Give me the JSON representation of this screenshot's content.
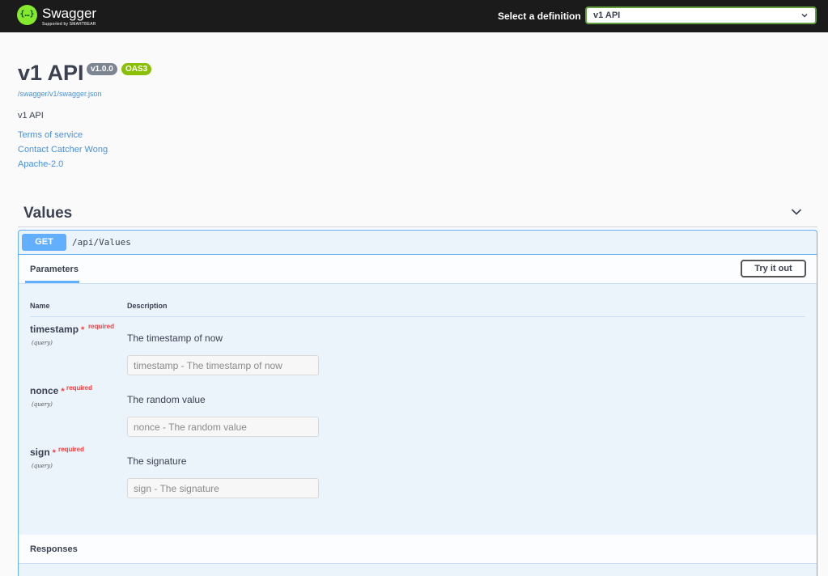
{
  "topbar": {
    "logo_text": "Swagger",
    "logo_sub": "Supported by SMARTBEAR",
    "logo_glyph": "{…}",
    "select_label": "Select a definition",
    "selected_definition": "v1 API"
  },
  "info": {
    "title": "v1 API",
    "version": "v1.0.0",
    "oas": "OAS3",
    "spec_url": "/swagger/v1/swagger.json",
    "description": "v1 API",
    "links": [
      "Terms of service",
      "Contact Catcher Wong",
      "Apache-2.0"
    ]
  },
  "tag": {
    "name": "Values"
  },
  "operation": {
    "method": "GET",
    "path": "/api/Values",
    "parameters_tab": "Parameters",
    "try_button": "Try it out",
    "columns": {
      "name": "Name",
      "description": "Description"
    },
    "params": [
      {
        "name": "timestamp",
        "star": "*",
        "required": "required",
        "in": "(query)",
        "description": "The timestamp of now",
        "placeholder": "timestamp - The timestamp of now"
      },
      {
        "name": "nonce",
        "star": "*",
        "required": "required",
        "in": "(query)",
        "description": "The random value",
        "placeholder": "nonce - The random value"
      },
      {
        "name": "sign",
        "star": "*",
        "required": "required",
        "in": "(query)",
        "description": "The signature",
        "placeholder": "sign - The signature"
      }
    ],
    "responses_title": "Responses"
  },
  "colors": {
    "topbar": "#1b1b1b",
    "brand_green": "#85ea2d",
    "get_blue": "#61affe",
    "required_red": "#ff3b3b",
    "link_blue": "#4990e2"
  }
}
